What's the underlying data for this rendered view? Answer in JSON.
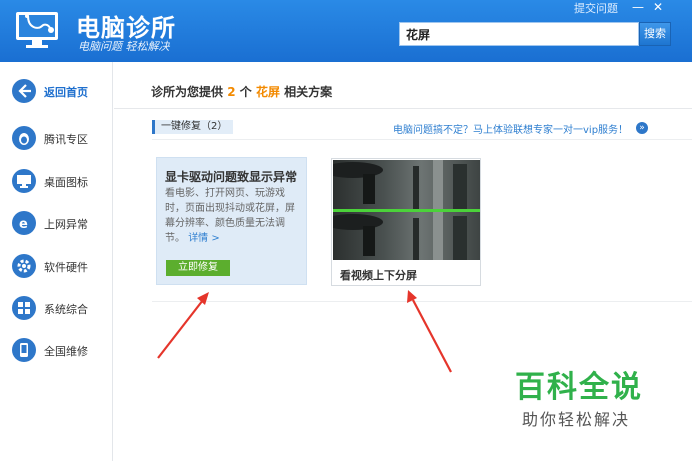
{
  "header": {
    "title": "电脑诊所",
    "slogan": "电脑问题 轻松解决",
    "top_link": "提交问题",
    "minimize_glyph": "—",
    "close_glyph": "✕",
    "search_value": "花屏",
    "search_button": "搜索"
  },
  "sidebar": {
    "items": [
      {
        "label": "返回首页",
        "icon": "back-arrow-icon",
        "active": true
      },
      {
        "label": "腾讯专区",
        "icon": "qq-penguin-icon"
      },
      {
        "label": "桌面图标",
        "icon": "monitor-icon"
      },
      {
        "label": "上网异常",
        "icon": "ie-browser-icon"
      },
      {
        "label": "软件硬件",
        "icon": "gear-icon"
      },
      {
        "label": "系统综合",
        "icon": "windows-logo-icon"
      },
      {
        "label": "全国维修",
        "icon": "phone-icon"
      }
    ]
  },
  "main": {
    "summary_prefix": "诊所为您提供",
    "summary_count": "2",
    "summary_unit": "个",
    "summary_keyword": "花屏",
    "summary_suffix": "相关方案",
    "section_label": "一键修复（2）",
    "vip_link": "电脑问题搞不定？马上体验联想专家一对一vip服务！",
    "vip_icon_glyph": "»"
  },
  "cards": [
    {
      "title": "显卡驱动问题致显示异常",
      "description": "看电影、打开网页、玩游戏时，页面出现抖动或花屏，屏幕分辨率、颜色质量无法调节。",
      "more": "详情 >",
      "button": "立即修复"
    },
    {
      "caption": "看视频上下分屏"
    }
  ],
  "watermark": {
    "main": "百科全说",
    "sub": "助你轻松解决"
  },
  "colors": {
    "header_blue": "#1a6fd2",
    "accent_orange": "#f38a00",
    "fix_green": "#5cae2e",
    "arrow_red": "#e5352b",
    "watermark_green": "#30b14b"
  }
}
